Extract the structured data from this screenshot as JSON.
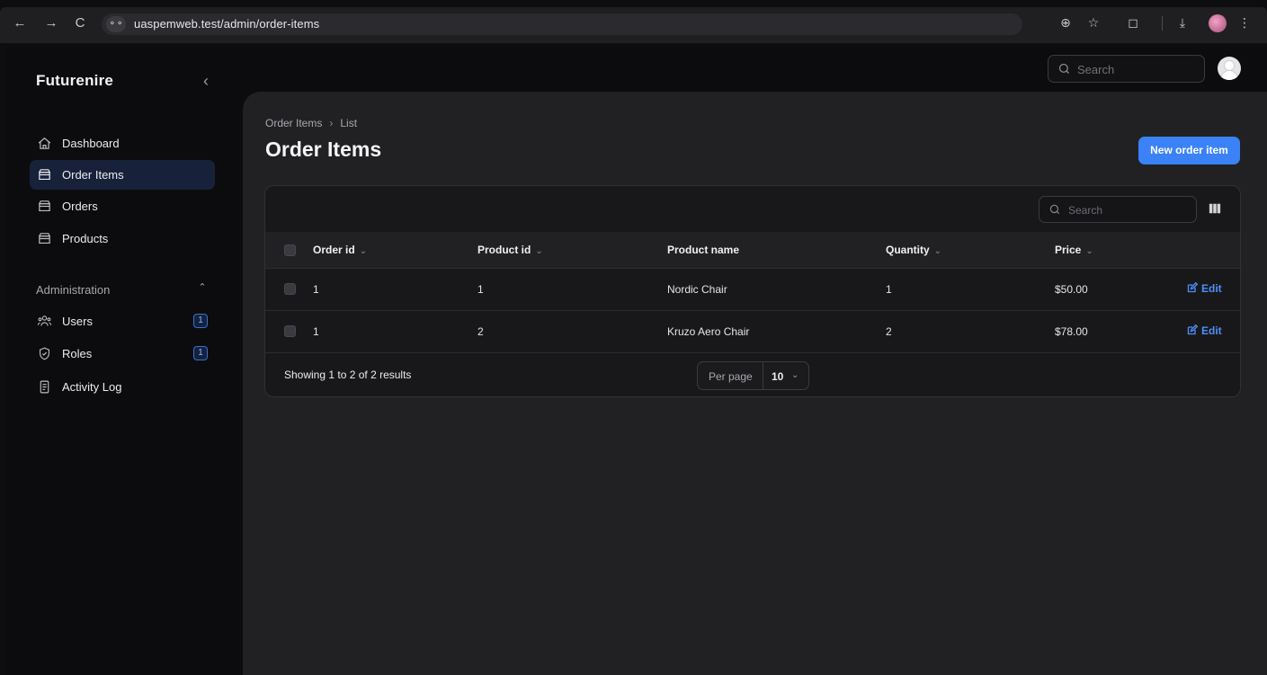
{
  "browser": {
    "url": "uaspemweb.test/admin/order-items",
    "site_icon": "⚬⚬"
  },
  "sidebar": {
    "brand": "Futurenire",
    "items": [
      {
        "label": "Dashboard",
        "icon": "home-icon",
        "active": false
      },
      {
        "label": "Order Items",
        "icon": "box-icon",
        "active": true
      },
      {
        "label": "Orders",
        "icon": "box-icon",
        "active": false
      },
      {
        "label": "Products",
        "icon": "box-icon",
        "active": false
      }
    ],
    "group": {
      "label": "Administration",
      "items": [
        {
          "label": "Users",
          "icon": "users-icon",
          "badge": "1"
        },
        {
          "label": "Roles",
          "icon": "shield-icon",
          "badge": "1"
        },
        {
          "label": "Activity Log",
          "icon": "document-icon"
        }
      ]
    }
  },
  "topbar": {
    "search_placeholder": "Search"
  },
  "page": {
    "breadcrumb": [
      "Order Items",
      "List"
    ],
    "title": "Order Items",
    "new_button": "New order item"
  },
  "table": {
    "search_placeholder": "Search",
    "columns": [
      "Order id",
      "Product id",
      "Product name",
      "Quantity",
      "Price"
    ],
    "rows": [
      {
        "order_id": "1",
        "product_id": "1",
        "product_name": "Nordic Chair",
        "quantity": "1",
        "price": "$50.00",
        "action": "Edit"
      },
      {
        "order_id": "1",
        "product_id": "2",
        "product_name": "Kruzo Aero Chair",
        "quantity": "2",
        "price": "$78.00",
        "action": "Edit"
      }
    ],
    "footer": {
      "showing": "Showing 1 to 2 of 2 results",
      "per_page_label": "Per page",
      "per_page_value": "10"
    }
  },
  "colors": {
    "accent": "#3b82f6",
    "active_nav": "#17223a",
    "link": "#4f8ff7"
  }
}
